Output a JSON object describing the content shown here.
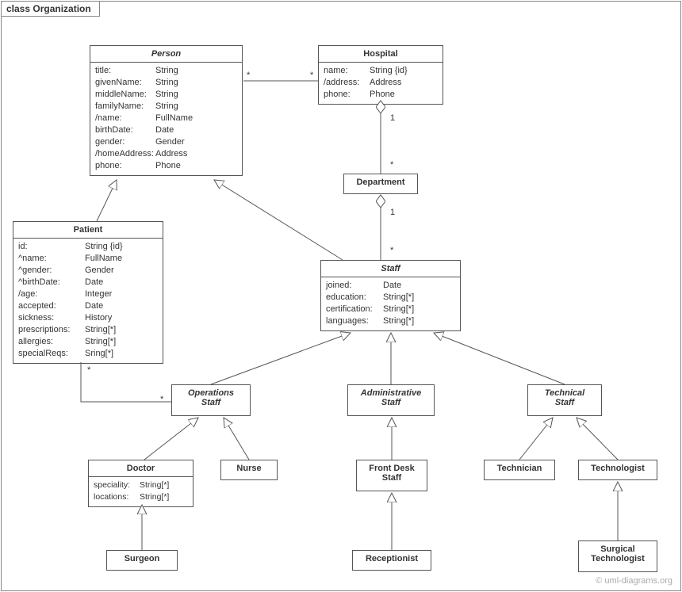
{
  "frame_label": "class Organization",
  "watermark": "© uml-diagrams.org",
  "classes": {
    "person": {
      "name": "Person",
      "attrs": [
        {
          "n": "title:",
          "t": "String"
        },
        {
          "n": "givenName:",
          "t": "String"
        },
        {
          "n": "middleName:",
          "t": "String"
        },
        {
          "n": "familyName:",
          "t": "String"
        },
        {
          "n": "/name:",
          "t": "FullName"
        },
        {
          "n": "birthDate:",
          "t": "Date"
        },
        {
          "n": "gender:",
          "t": "Gender"
        },
        {
          "n": "/homeAddress:",
          "t": "Address"
        },
        {
          "n": "phone:",
          "t": "Phone"
        }
      ]
    },
    "hospital": {
      "name": "Hospital",
      "attrs": [
        {
          "n": "name:",
          "t": "String {id}"
        },
        {
          "n": "/address:",
          "t": "Address"
        },
        {
          "n": "phone:",
          "t": "Phone"
        }
      ]
    },
    "department": {
      "name": "Department"
    },
    "patient": {
      "name": "Patient",
      "attrs": [
        {
          "n": "id:",
          "t": "String {id}"
        },
        {
          "n": "^name:",
          "t": "FullName"
        },
        {
          "n": "^gender:",
          "t": "Gender"
        },
        {
          "n": "^birthDate:",
          "t": "Date"
        },
        {
          "n": "/age:",
          "t": "Integer"
        },
        {
          "n": "accepted:",
          "t": "Date"
        },
        {
          "n": "sickness:",
          "t": "History"
        },
        {
          "n": "prescriptions:",
          "t": "String[*]"
        },
        {
          "n": "allergies:",
          "t": "String[*]"
        },
        {
          "n": "specialReqs:",
          "t": "Sring[*]"
        }
      ]
    },
    "staff": {
      "name": "Staff",
      "attrs": [
        {
          "n": "joined:",
          "t": "Date"
        },
        {
          "n": "education:",
          "t": "String[*]"
        },
        {
          "n": "certification:",
          "t": "String[*]"
        },
        {
          "n": "languages:",
          "t": "String[*]"
        }
      ]
    },
    "opsStaff": {
      "name": "Operations\nStaff"
    },
    "adminStaff": {
      "name": "Administrative\nStaff"
    },
    "techStaff": {
      "name": "Technical\nStaff"
    },
    "doctor": {
      "name": "Doctor",
      "attrs": [
        {
          "n": "speciality:",
          "t": "String[*]"
        },
        {
          "n": "locations:",
          "t": "String[*]"
        }
      ]
    },
    "nurse": {
      "name": "Nurse"
    },
    "frontdesk": {
      "name": "Front Desk\nStaff"
    },
    "receptionist": {
      "name": "Receptionist"
    },
    "technician": {
      "name": "Technician"
    },
    "technologist": {
      "name": "Technologist"
    },
    "surgtech": {
      "name": "Surgical\nTechnologist"
    },
    "surgeon": {
      "name": "Surgeon"
    }
  },
  "multiplicities": {
    "person_hospital_l": "*",
    "person_hospital_r": "*",
    "hospital_dept_top": "1",
    "hospital_dept_bot": "*",
    "dept_staff_top": "1",
    "dept_staff_bot": "*",
    "patient_ops_l": "*",
    "patient_ops_r": "*"
  }
}
